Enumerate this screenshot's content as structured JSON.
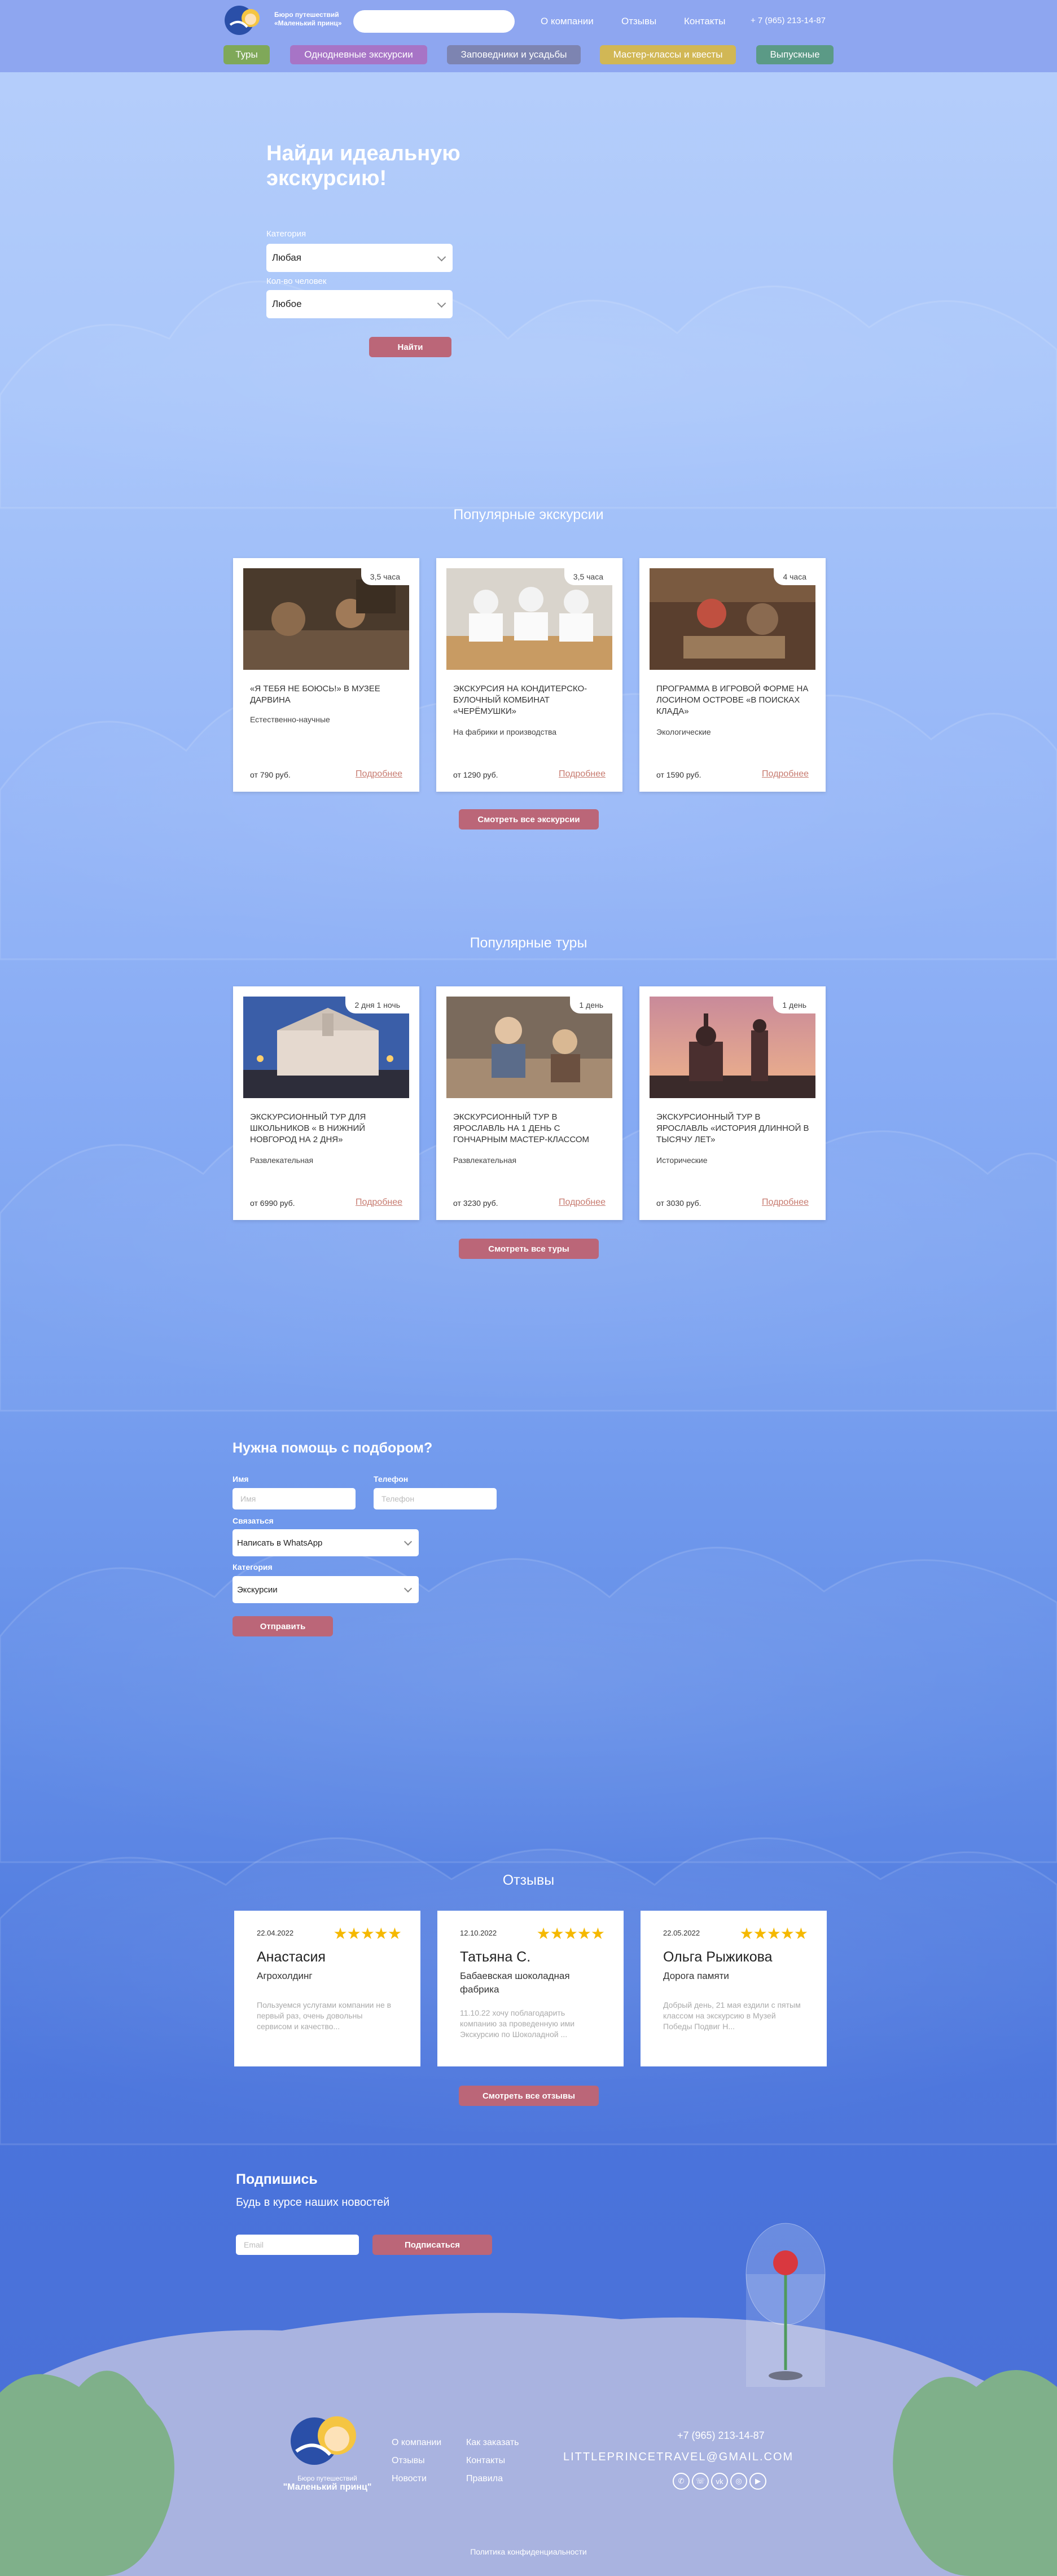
{
  "header": {
    "logo_line1": "Бюро путешествий",
    "logo_line2": "«Маленький принц»",
    "search_placeholder": "",
    "nav": [
      "О компании",
      "Отзывы",
      "Контакты"
    ],
    "phone": "+ 7 (965) 213-14-87",
    "tabs": [
      {
        "label": "Туры",
        "color": "#7fa859"
      },
      {
        "label": "Однодневные экскурсии",
        "color": "#a774c6"
      },
      {
        "label": "Заповедники и усадьбы",
        "color": "#7d84b1"
      },
      {
        "label": "Мастер-классы и квесты",
        "color": "#d1b755"
      },
      {
        "label": "Выпускные",
        "color": "#5b9a86"
      }
    ]
  },
  "hero": {
    "title": "Найди идеальную экскурсию!",
    "category_label": "Категория",
    "category_value": "Любая",
    "people_label": "Кол-во человек",
    "people_value": "Любое",
    "find_button": "Найти"
  },
  "excursions": {
    "title": "Популярные экскурсии",
    "cards": [
      {
        "badge": "3,5 часа",
        "title": "«Я тебя не боюсь!» в Музее Дарвина",
        "category": "Естественно-научные",
        "price": "от 790 руб.",
        "more": "Подробнее"
      },
      {
        "badge": "3,5 часа",
        "title": "Экскурсия на кондитерско-булочный комбинат «Черёмушки»",
        "category": "На фабрики и производства",
        "price": "от 1290 руб.",
        "more": "Подробнее"
      },
      {
        "badge": "4 часа",
        "title": "Программа в игровой форме на Лосином острове «В поисках клада»",
        "category": "Экологические",
        "price": "от 1590 руб.",
        "more": "Подробнее"
      }
    ],
    "all_button": "Смотреть все экскурсии"
  },
  "tours": {
    "title": "Популярные туры",
    "cards": [
      {
        "badge": "2 дня 1 ночь",
        "title": "Экскурсионный тур для школьников « в Нижний Новгород на 2 дня»",
        "category": "Развлекательная",
        "price": "от 6990 руб.",
        "more": "Подробнее"
      },
      {
        "badge": "1 день",
        "title": "Экскурсионный тур в Ярославль на 1 день с гончарным мастер-классом",
        "category": "Развлекательная",
        "price": "от 3230 руб.",
        "more": "Подробнее"
      },
      {
        "badge": "1 день",
        "title": "Экскурсионный тур в Ярославль «История длинной в тысячу лет»",
        "category": "Исторические",
        "price": "от 3030 руб.",
        "more": "Подробнее"
      }
    ],
    "all_button": "Смотреть все туры"
  },
  "help": {
    "title": "Нужна помощь с подбором?",
    "name_label": "Имя",
    "name_placeholder": "Имя",
    "phone_label": "Телефон",
    "phone_placeholder": "Телефон",
    "contact_label": "Связаться",
    "contact_value": "Написать в WhatsApp",
    "category_label": "Категория",
    "category_value": "Экскурсии",
    "submit": "Отправить"
  },
  "reviews": {
    "title": "Отзывы",
    "items": [
      {
        "date": "22.04.2022",
        "stars": "★★★★★",
        "name": "Анастасия",
        "org": "Агрохолдинг",
        "text": "Пользуемся услугами компании не в первый раз, очень довольны сервисом и качество..."
      },
      {
        "date": "12.10.2022",
        "stars": "★★★★★",
        "name": "Татьяна С.",
        "org": "Бабаевская шоколадная фабрика",
        "text": "11.10.22 хочу поблагодарить компанию за проведенную ими Экскурсию по Шоколадной ..."
      },
      {
        "date": "22.05.2022",
        "stars": "★★★★★",
        "name": "Ольга Рыжикова",
        "org": "Дорога памяти",
        "text": "Добрый день, 21 мая ездили с пятым классом на экскурсию в Музей Победы Подвиг Н..."
      }
    ],
    "all_button": "Смотреть все отзывы"
  },
  "subscribe": {
    "title": "Подпишись",
    "text": "Будь в курсе наших новостей",
    "email_placeholder": "Email",
    "button": "Подписаться"
  },
  "footer": {
    "logo_line1": "Бюро путешествий",
    "logo_line2": "\"Маленький принц\"",
    "links_col1": [
      "О компании",
      "Отзывы",
      "Новости"
    ],
    "links_col2": [
      "Как заказать",
      "Контакты",
      "Правила"
    ],
    "phone": "+7 (965) 213-14-87",
    "email": "LITTLEPRINCETRAVEL@GMAIL.COM",
    "social_icons": [
      "whatsapp-icon",
      "viber-icon",
      "vk-icon",
      "instagram-icon",
      "youtube-icon"
    ],
    "policy": "Политика конфиденциальности"
  },
  "colors": {
    "accent": "#bb6678",
    "header": "#8ea6f0",
    "link": "#c77b70"
  }
}
